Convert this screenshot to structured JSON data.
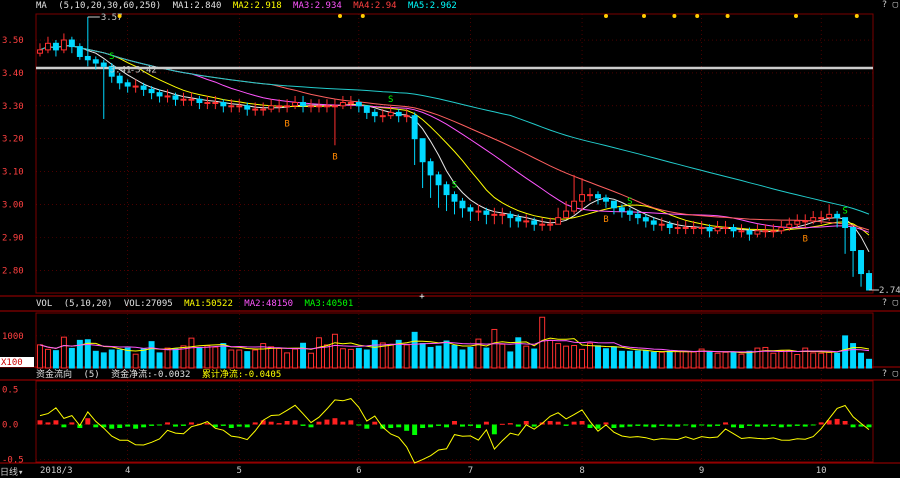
{
  "panel_price": {
    "label": "MA",
    "params": "(5,10,20,30,60,250)",
    "ma1": "MA1:2.840",
    "ma2": "MA2:2.918",
    "ma3": "MA3:2.934",
    "ma4": "MA4:2.94",
    "ma5": "MA5:2.962",
    "annot_high": "3.57",
    "annot_mid": "3.41",
    "annot_mid2": "3.42",
    "annot_last": "2.74",
    "buy_mark": "B",
    "sell_mark": "S"
  },
  "panel_vol": {
    "label": "VOL",
    "params": "(5,10,20)",
    "vol": "VOL:27095",
    "ma1": "MA1:50522",
    "ma2": "MA2:48150",
    "ma3": "MA3:40501",
    "tick_hi": "1000",
    "tick_lo": "X100"
  },
  "panel_ind": {
    "label": "资金流向",
    "params": "(5)",
    "v1": "资金净流:-0.0032",
    "v2": "累计净流:-0.0405"
  },
  "footer": {
    "period": "日线"
  },
  "colors": {
    "up": "#ff3030",
    "down": "#00d8ff",
    "ma5": "#e8e8e8",
    "ma10": "#ffff00",
    "ma20": "#ff55ff",
    "ma30": "#ff6060",
    "ma60": "#22cccc",
    "grid": "#7a0000"
  },
  "chart_data": {
    "type": "candlestick",
    "x": {
      "labels": [
        "2018/3",
        "4",
        "5",
        "6",
        "7",
        "8",
        "9",
        "10"
      ]
    },
    "price_axis": {
      "ticks": [
        3.5,
        3.4,
        3.3,
        3.2,
        3.1,
        3.0,
        2.9,
        2.8
      ],
      "ylim": [
        2.74,
        3.57
      ]
    },
    "price": {
      "open": [
        3.46,
        3.47,
        3.49,
        3.47,
        3.5,
        3.48,
        3.45,
        3.44,
        3.43,
        3.42,
        3.39,
        3.37,
        3.36,
        3.36,
        3.35,
        3.34,
        3.33,
        3.33,
        3.32,
        3.32,
        3.32,
        3.31,
        3.31,
        3.31,
        3.3,
        3.3,
        3.3,
        3.29,
        3.29,
        3.29,
        3.3,
        3.3,
        3.3,
        3.31,
        3.3,
        3.3,
        3.3,
        3.3,
        3.3,
        3.31,
        3.31,
        3.3,
        3.28,
        3.27,
        3.27,
        3.28,
        3.27,
        3.27,
        3.2,
        3.13,
        3.09,
        3.06,
        3.03,
        3.01,
        2.99,
        2.98,
        2.98,
        2.97,
        2.97,
        2.97,
        2.96,
        2.95,
        2.95,
        2.94,
        2.94,
        2.94,
        2.96,
        2.98,
        3.01,
        3.03,
        3.03,
        3.02,
        3.01,
        2.99,
        2.98,
        2.97,
        2.96,
        2.95,
        2.94,
        2.94,
        2.93,
        2.93,
        2.93,
        2.93,
        2.93,
        2.92,
        2.93,
        2.93,
        2.92,
        2.92,
        2.91,
        2.92,
        2.92,
        2.92,
        2.93,
        2.94,
        2.95,
        2.95,
        2.96,
        2.96,
        2.97,
        2.96,
        2.93,
        2.86,
        2.79
      ],
      "close": [
        3.47,
        3.49,
        3.47,
        3.5,
        3.48,
        3.45,
        3.44,
        3.43,
        3.42,
        3.39,
        3.37,
        3.36,
        3.36,
        3.35,
        3.34,
        3.33,
        3.33,
        3.32,
        3.32,
        3.32,
        3.31,
        3.31,
        3.31,
        3.3,
        3.3,
        3.3,
        3.29,
        3.29,
        3.29,
        3.3,
        3.3,
        3.3,
        3.31,
        3.3,
        3.3,
        3.3,
        3.3,
        3.3,
        3.31,
        3.31,
        3.3,
        3.28,
        3.27,
        3.27,
        3.28,
        3.27,
        3.27,
        3.2,
        3.13,
        3.09,
        3.06,
        3.03,
        3.01,
        2.99,
        2.98,
        2.98,
        2.97,
        2.97,
        2.97,
        2.96,
        2.95,
        2.95,
        2.94,
        2.94,
        2.94,
        2.96,
        2.98,
        3.01,
        3.03,
        3.03,
        3.02,
        3.01,
        2.99,
        2.98,
        2.97,
        2.96,
        2.95,
        2.94,
        2.94,
        2.93,
        2.93,
        2.93,
        2.93,
        2.93,
        2.92,
        2.93,
        2.93,
        2.92,
        2.92,
        2.91,
        2.92,
        2.92,
        2.92,
        2.93,
        2.94,
        2.95,
        2.95,
        2.96,
        2.96,
        2.97,
        2.96,
        2.93,
        2.86,
        2.79,
        2.74
      ],
      "high": [
        3.49,
        3.51,
        3.5,
        3.52,
        3.51,
        3.49,
        3.57,
        3.45,
        3.44,
        3.43,
        3.4,
        3.38,
        3.38,
        3.37,
        3.36,
        3.35,
        3.35,
        3.34,
        3.34,
        3.34,
        3.33,
        3.33,
        3.33,
        3.32,
        3.32,
        3.32,
        3.31,
        3.31,
        3.31,
        3.32,
        3.32,
        3.32,
        3.33,
        3.33,
        3.32,
        3.32,
        3.32,
        3.32,
        3.33,
        3.33,
        3.32,
        3.3,
        3.29,
        3.29,
        3.3,
        3.29,
        3.29,
        3.28,
        3.2,
        3.14,
        3.1,
        3.07,
        3.04,
        3.02,
        3.0,
        3.0,
        2.99,
        2.99,
        2.99,
        2.98,
        2.97,
        2.97,
        2.96,
        2.96,
        2.96,
        2.99,
        3.01,
        3.09,
        3.08,
        3.05,
        3.04,
        3.03,
        3.01,
        3.0,
        2.99,
        2.98,
        2.97,
        2.96,
        2.96,
        2.95,
        2.95,
        2.95,
        2.95,
        2.95,
        2.94,
        2.95,
        2.95,
        2.94,
        2.94,
        2.93,
        2.94,
        2.94,
        2.94,
        2.95,
        2.96,
        2.97,
        2.97,
        2.98,
        2.98,
        3.0,
        2.98,
        2.96,
        2.93,
        2.86,
        2.8
      ],
      "low": [
        3.45,
        3.46,
        3.45,
        3.46,
        3.46,
        3.44,
        3.42,
        3.41,
        3.26,
        3.37,
        3.35,
        3.34,
        3.34,
        3.33,
        3.32,
        3.31,
        3.31,
        3.3,
        3.3,
        3.3,
        3.29,
        3.29,
        3.29,
        3.28,
        3.28,
        3.28,
        3.27,
        3.27,
        3.27,
        3.28,
        3.28,
        3.28,
        3.29,
        3.28,
        3.28,
        3.28,
        3.28,
        3.18,
        3.29,
        3.29,
        3.28,
        3.26,
        3.25,
        3.25,
        3.26,
        3.25,
        3.25,
        3.12,
        3.05,
        3.02,
        2.99,
        2.98,
        2.97,
        2.96,
        2.95,
        2.95,
        2.94,
        2.94,
        2.94,
        2.93,
        2.93,
        2.93,
        2.92,
        2.92,
        2.92,
        2.94,
        2.96,
        2.97,
        2.98,
        3.01,
        3.0,
        2.99,
        2.97,
        2.96,
        2.95,
        2.94,
        2.93,
        2.92,
        2.92,
        2.91,
        2.91,
        2.91,
        2.91,
        2.91,
        2.9,
        2.91,
        2.91,
        2.9,
        2.9,
        2.89,
        2.9,
        2.9,
        2.9,
        2.91,
        2.92,
        2.93,
        2.93,
        2.94,
        2.94,
        2.95,
        2.93,
        2.85,
        2.78,
        2.75,
        2.74
      ]
    },
    "volume": [
      720,
      580,
      540,
      960,
      610,
      860,
      880,
      520,
      470,
      560,
      560,
      620,
      430,
      600,
      820,
      470,
      620,
      590,
      690,
      930,
      630,
      690,
      650,
      760,
      560,
      560,
      510,
      560,
      760,
      660,
      610,
      470,
      590,
      770,
      460,
      940,
      720,
      1050,
      600,
      580,
      610,
      560,
      860,
      780,
      720,
      860,
      720,
      1110,
      760,
      640,
      680,
      840,
      700,
      560,
      640,
      900,
      620,
      1200,
      740,
      500,
      940,
      680,
      590,
      1580,
      860,
      760,
      680,
      700,
      580,
      770,
      690,
      600,
      660,
      520,
      520,
      530,
      530,
      490,
      490,
      520,
      520,
      510,
      500,
      590,
      500,
      460,
      490,
      500,
      430,
      520,
      620,
      640,
      460,
      530,
      540,
      420,
      620,
      470,
      460,
      490,
      460,
      1000,
      760,
      460,
      270
    ],
    "indicator": [
      0.06,
      0.03,
      0.06,
      -0.04,
      0.03,
      -0.05,
      0.09,
      -0.04,
      -0.04,
      -0.06,
      -0.05,
      -0.03,
      -0.06,
      -0.04,
      -0.02,
      -0.01,
      0.03,
      -0.03,
      -0.02,
      0.03,
      0.01,
      0.02,
      -0.04,
      -0.02,
      -0.05,
      -0.03,
      -0.04,
      0.03,
      0.06,
      0.04,
      0.02,
      0.05,
      0.06,
      -0.02,
      -0.04,
      0.04,
      0.07,
      0.09,
      0.04,
      0.06,
      -0.01,
      -0.06,
      0.04,
      -0.06,
      -0.05,
      -0.04,
      -0.09,
      -0.15,
      -0.05,
      -0.04,
      -0.02,
      -0.04,
      0.05,
      -0.03,
      -0.02,
      -0.05,
      0.04,
      -0.14,
      0.01,
      0.02,
      -0.03,
      0.05,
      -0.03,
      0.03,
      0.05,
      0.04,
      -0.02,
      0.04,
      0.05,
      -0.05,
      -0.06,
      0.03,
      -0.05,
      -0.04,
      -0.03,
      -0.02,
      -0.03,
      -0.04,
      -0.02,
      -0.03,
      -0.03,
      -0.01,
      -0.04,
      -0.01,
      -0.03,
      -0.02,
      0.03,
      -0.04,
      -0.05,
      -0.02,
      -0.03,
      -0.03,
      -0.02,
      -0.04,
      -0.03,
      -0.02,
      -0.03,
      -0.01,
      0.03,
      0.06,
      0.08,
      0.05,
      -0.04,
      -0.03,
      -0.04
    ],
    "indicator_axis": {
      "ticks": [
        0.5,
        0.0,
        -0.5
      ],
      "tick_labels": [
        "0.5",
        "0.0",
        "-0.5"
      ]
    },
    "buy_marks": [
      37,
      31,
      71,
      96
    ],
    "sell_marks": [
      9,
      44,
      52,
      74,
      101
    ]
  }
}
